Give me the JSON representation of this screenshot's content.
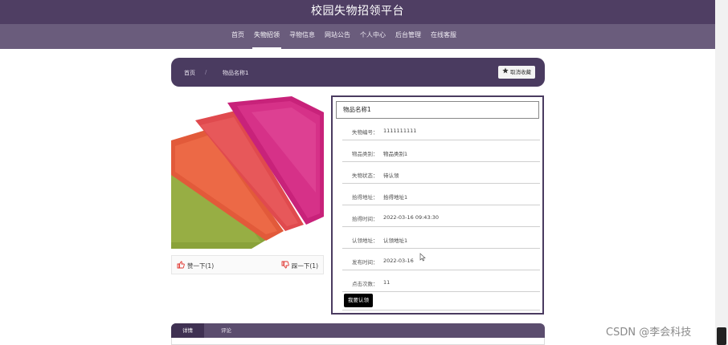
{
  "site": {
    "title": "校园失物招领平台"
  },
  "nav": [
    {
      "label": "首页"
    },
    {
      "label": "失物招领"
    },
    {
      "label": "寻物信息"
    },
    {
      "label": "网站公告"
    },
    {
      "label": "个人中心"
    },
    {
      "label": "后台管理"
    },
    {
      "label": "在线客服"
    }
  ],
  "nav_active": "失物招领",
  "breadcrumb": {
    "home": "首页",
    "separator": "/",
    "current": "物品名称1"
  },
  "favorite": {
    "label": "取消收藏",
    "icon": "star-icon"
  },
  "item": {
    "title": "物品名称1",
    "fields": [
      {
        "label": "失物编号：",
        "value": "1111111111"
      },
      {
        "label": "物品类别：",
        "value": "物品类别1"
      },
      {
        "label": "失物状态：",
        "value": "待认领"
      },
      {
        "label": "拾得地址：",
        "value": "拾得地址1"
      },
      {
        "label": "拾得时间：",
        "value": "2022-03-16 09:43:30"
      },
      {
        "label": "认领地址：",
        "value": "认领地址1"
      },
      {
        "label": "发布时间：",
        "value": "2022-03-16"
      },
      {
        "label": "点击次数：",
        "value": "11"
      }
    ],
    "claim_label": "我要认领"
  },
  "votes": {
    "up_label": "赞一下(1)",
    "down_label": "踩一下(1)"
  },
  "tabs": [
    {
      "label": "详情"
    },
    {
      "label": "评论"
    }
  ],
  "watermark": "CSDN @李会科技",
  "colors": {
    "header": "#4f3e63",
    "nav": "#6a5c7c",
    "panel_border": "#4a3b60",
    "thumb_red": "#e0342e"
  }
}
